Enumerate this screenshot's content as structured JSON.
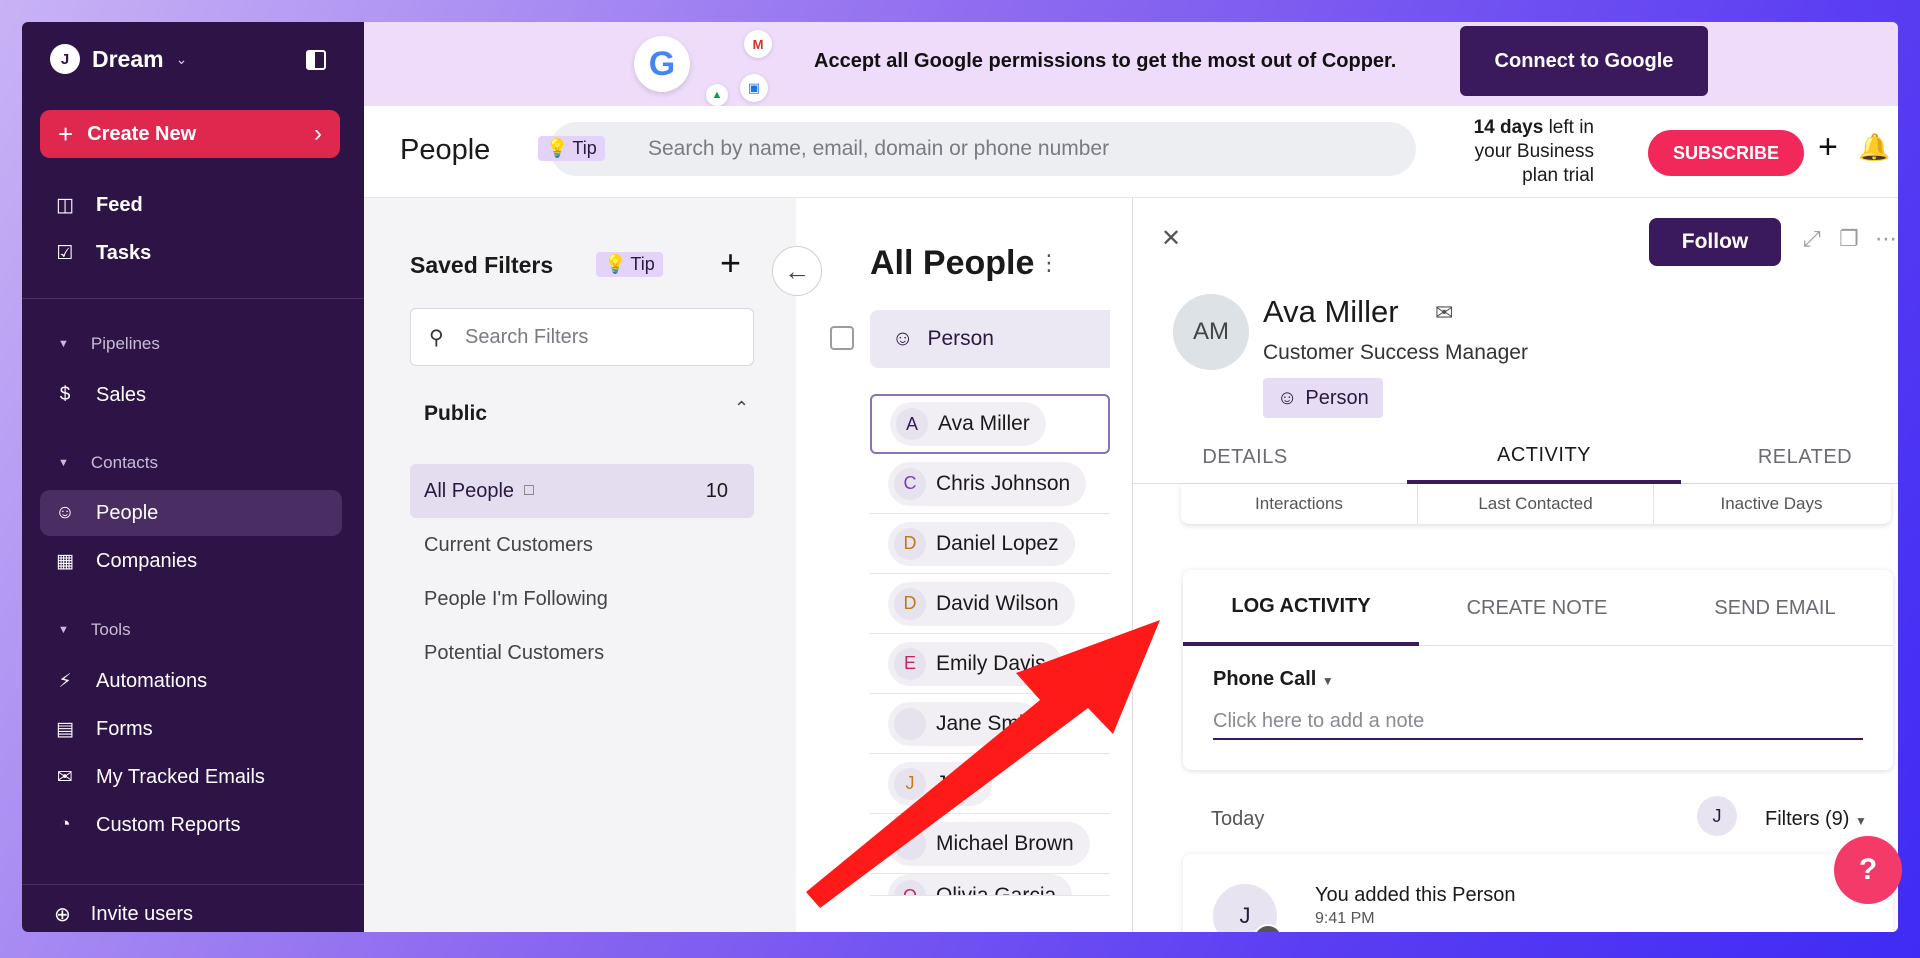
{
  "sidebar": {
    "workspace_initial": "J",
    "workspace_name": "Dream",
    "create_new": "Create New",
    "feed": "Feed",
    "tasks": "Tasks",
    "pipelines_header": "Pipelines",
    "sales": "Sales",
    "contacts_header": "Contacts",
    "people": "People",
    "companies": "Companies",
    "tools_header": "Tools",
    "automations": "Automations",
    "forms": "Forms",
    "tracked_emails": "My Tracked Emails",
    "custom_reports": "Custom Reports",
    "invite": "Invite users"
  },
  "banner": {
    "g": "G",
    "m": "M",
    "text": "Accept all Google permissions to get the most out of Copper.",
    "connect": "Connect to Google"
  },
  "header": {
    "title": "People",
    "tip": "Tip",
    "search_placeholder": "Search by name, email, domain or phone number",
    "trial_days": "14 days",
    "trial_rest1": " left in",
    "trial_line2": "your Business",
    "trial_line3": "plan trial",
    "subscribe": "SUBSCRIBE"
  },
  "filters": {
    "title": "Saved Filters",
    "tip": "Tip",
    "search_placeholder": "Search Filters",
    "public": "Public",
    "items": [
      {
        "label": "All People",
        "count": "10"
      },
      {
        "label": "Current Customers"
      },
      {
        "label": "People I'm Following"
      },
      {
        "label": "Potential Customers"
      }
    ]
  },
  "list": {
    "title": "All People",
    "column": "Person",
    "people": [
      {
        "initial": "A",
        "name": "Ava Miller",
        "color": "#3a1a5c"
      },
      {
        "initial": "C",
        "name": "Chris Johnson",
        "color": "#7a3fb0"
      },
      {
        "initial": "D",
        "name": "Daniel Lopez",
        "color": "#c07a1a"
      },
      {
        "initial": "D",
        "name": "David Wilson",
        "color": "#c07a1a"
      },
      {
        "initial": "E",
        "name": "Emily Davis",
        "color": "#c0285a"
      },
      {
        "initial": "",
        "name": "Jane Smi",
        "color": "#888888"
      },
      {
        "initial": "J",
        "name": "J      oe",
        "color": "#c07a1a"
      },
      {
        "initial": "",
        "name": "Michael Brown",
        "color": "#3a1a5c"
      },
      {
        "initial": "O",
        "name": "Olivia Garcia",
        "color": "#c0285a"
      }
    ]
  },
  "detail": {
    "follow": "Follow",
    "initials": "AM",
    "name": "Ava Miller",
    "role": "Customer Success Manager",
    "badge": "Person",
    "tabs": [
      "DETAILS",
      "ACTIVITY",
      "RELATED"
    ],
    "stats": [
      "Interactions",
      "Last Contacted",
      "Inactive Days"
    ],
    "log_tabs": [
      "LOG ACTIVITY",
      "CREATE NOTE",
      "SEND EMAIL"
    ],
    "call_type": "Phone Call",
    "note_placeholder": "Click here to add a note",
    "today": "Today",
    "user_initial": "J",
    "filters": "Filters (9)",
    "feed_title": "You added this Person",
    "feed_time": "9:41 PM"
  },
  "colors": {
    "sidebar_bg": "#2e1446",
    "accent": "#3a1a5c",
    "create": "#e0284f",
    "subscribe": "#f3285a",
    "arrow": "#ff1a1a"
  },
  "icons": [
    "chevron-down-icon",
    "sidebar-toggle-icon",
    "plus-icon",
    "chevron-right-icon",
    "inbox-icon",
    "check-square-icon",
    "dollar-icon",
    "person-icon",
    "building-icon",
    "lightning-icon",
    "clipboard-icon",
    "mail-icon",
    "pie-chart-icon",
    "plus-circle-icon",
    "search-icon",
    "bell-icon",
    "bulb-icon",
    "bookmark-icon",
    "arrow-left-icon",
    "close-icon",
    "expand-icon",
    "copy-icon",
    "more-icon",
    "help-icon"
  ]
}
